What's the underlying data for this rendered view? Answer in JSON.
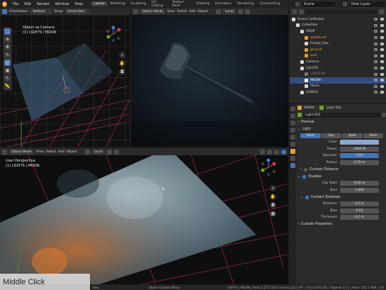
{
  "topbar": {
    "menus": [
      "File",
      "Edit",
      "Render",
      "Window",
      "Help"
    ],
    "workspaces": [
      "Layout",
      "Modeling",
      "Sculpting",
      "UV Editing",
      "Texture Paint",
      "Shading",
      "Animation",
      "Rendering",
      "Compositing"
    ],
    "active_workspace": "Layout",
    "scene": "Scene",
    "view_layer": "View Layer"
  },
  "toolheader": {
    "orientation_label": "Orientation:",
    "orientation_value": "Default",
    "drag_label": "Drag:",
    "drag_value": "Select Box"
  },
  "viewport_tl": {
    "mode": "Object Mode",
    "menus": [
      "View",
      "Select",
      "Add",
      "Object"
    ],
    "overlay_line1": "Object as Camera",
    "overlay_line2": "(1) LIGHTS | MOON"
  },
  "viewport_tr": {
    "mode": "Object Mode",
    "menus": [
      "View",
      "Select",
      "Add",
      "Object"
    ],
    "transform": "Local"
  },
  "viewport_bottom": {
    "mode": "Object Mode",
    "menus": [
      "View",
      "Select",
      "Add",
      "Object"
    ],
    "transform": "Local",
    "overlay_line1": "User Perspective",
    "overlay_line2": "(1) LIGHTS | MOON"
  },
  "outliner": {
    "items": [
      {
        "label": "Scene Collection",
        "indent": 0,
        "color": "#d6d6d6"
      },
      {
        "label": "Collection",
        "indent": 1,
        "color": "#d6d6d6"
      },
      {
        "label": "PROP",
        "indent": 2,
        "color": "#d6d6d6"
      },
      {
        "label": "axeMount",
        "indent": 3,
        "color": "#e89b3a"
      },
      {
        "label": "Empty_Axe",
        "indent": 3,
        "color": "#d6d6d6"
      },
      {
        "label": "ground",
        "indent": 3,
        "color": "#e89b3a"
      },
      {
        "label": "wall",
        "indent": 3,
        "color": "#e89b3a"
      },
      {
        "label": "Camera",
        "indent": 2,
        "color": "#d6d6d6"
      },
      {
        "label": "LIGHTS",
        "indent": 2,
        "color": "#d6d6d6"
      },
      {
        "label": "LANTERN",
        "indent": 3,
        "color": "#777777"
      },
      {
        "label": "MOON",
        "indent": 3,
        "color": "#ffffff",
        "selected": true
      },
      {
        "label": "Plane",
        "indent": 3,
        "color": "#d6d6d6"
      },
      {
        "label": "GOBOS",
        "indent": 2,
        "color": "#d6d6d6"
      }
    ]
  },
  "properties": {
    "object_name": "MOON",
    "data_name": "Light.001",
    "field_name": "Light.001",
    "preview_label": "Preview",
    "light_label": "Light",
    "light_types": [
      "Point",
      "Sun",
      "Spot",
      "Area"
    ],
    "active_type": "Point",
    "color_label": "Color",
    "color_value": "#8aa9d6",
    "power_label": "Power",
    "power_value": "1600 W",
    "specular_label": "Specular",
    "specular_value": "1.00",
    "radius_label": "Radius",
    "radius_value": "0.25 m",
    "custom_distance_label": "Custom Distance",
    "shadow_label": "Shadow",
    "clip_start_label": "Clip Start",
    "clip_start_value": "0.05 m",
    "bias_label": "Bias",
    "bias_value": "1.000",
    "contact_shadows_label": "Contact Shadows",
    "distance_label": "Distance",
    "distance_value": "0.2 m",
    "cbias_label": "Bias",
    "cbias_value": "0.03",
    "thickness_label": "Thickness",
    "thickness_value": "0.2 m",
    "custom_properties_label": "Custom Properties"
  },
  "statusbar": {
    "left": "View",
    "middle": "Object Context Menu",
    "right": "LIGHTS | MOON | Verts:2,257,324 | Faces:2,252,397 | Tris:4,104,762 | Objects:1/11 | Mem: 552.1 MiB | 2.8"
  },
  "overlay_caption": "Middle Click"
}
